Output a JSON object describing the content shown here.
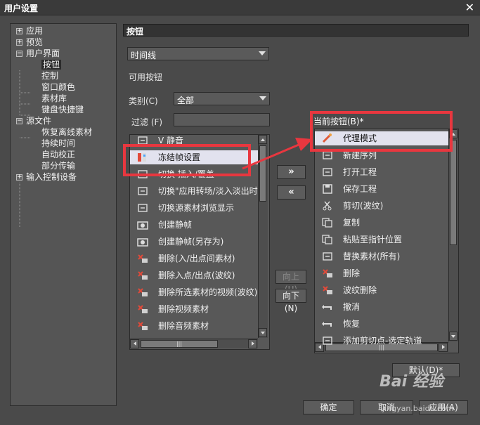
{
  "window": {
    "title": "用户设置",
    "close_glyph": "✕"
  },
  "tree": [
    {
      "label": "应用",
      "level": 0,
      "expander": "+"
    },
    {
      "label": "预览",
      "level": 0,
      "expander": "+"
    },
    {
      "label": "用户界面",
      "level": 0,
      "expander": "−"
    },
    {
      "label": "按钮",
      "level": 1,
      "selected": true
    },
    {
      "label": "控制",
      "level": 1
    },
    {
      "label": "窗口颜色",
      "level": 1
    },
    {
      "label": "素材库",
      "level": 1
    },
    {
      "label": "键盘快捷键",
      "level": 1
    },
    {
      "label": "源文件",
      "level": 0,
      "expander": "−"
    },
    {
      "label": "恢复离线素材",
      "level": 1
    },
    {
      "label": "持续时间",
      "level": 1
    },
    {
      "label": "自动校正",
      "level": 1
    },
    {
      "label": "部分传输",
      "level": 1
    },
    {
      "label": "输入控制设备",
      "level": 0,
      "expander": "+"
    }
  ],
  "section_title": "按钮",
  "view_combo": {
    "value": "时间线"
  },
  "available_buttons_label": "可用按钮",
  "category": {
    "label": "类别(C)",
    "value": "全部"
  },
  "filter": {
    "label": "过滤 (F)",
    "value": ""
  },
  "current_buttons_label": "当前按钮(B)*",
  "available_items": [
    {
      "label": "V 静音",
      "icon": "mute-icon"
    },
    {
      "label": "冻结帧设置",
      "icon": "freeze-frame-icon",
      "highlighted": true
    },
    {
      "label": "切换 插入/覆盖",
      "icon": "insert-overwrite-icon"
    },
    {
      "label": "切换\"应用转场/淡入淡出时",
      "icon": "transition-icon"
    },
    {
      "label": "切换源素材浏览显示",
      "icon": "source-view-icon"
    },
    {
      "label": "创建静帧",
      "icon": "camera-icon"
    },
    {
      "label": "创建静帧(另存为)",
      "icon": "camera-save-icon"
    },
    {
      "label": "删除(入/出点间素材)",
      "icon": "delete-inout-icon"
    },
    {
      "label": "删除入点/出点(波纹)",
      "icon": "delete-ripple-icon"
    },
    {
      "label": "删除所选素材的视频(波纹)",
      "icon": "delete-video-ripple-icon"
    },
    {
      "label": "删除视频素材",
      "icon": "delete-video-icon"
    },
    {
      "label": "删除音频素材",
      "icon": "delete-audio-icon"
    }
  ],
  "current_items": [
    {
      "label": "代理模式",
      "icon": "proxy-icon",
      "highlighted": true
    },
    {
      "label": "新建序列",
      "icon": "new-sequence-icon"
    },
    {
      "label": "打开工程",
      "icon": "open-project-icon"
    },
    {
      "label": "保存工程",
      "icon": "save-icon"
    },
    {
      "label": "剪切(波纹)",
      "icon": "scissors-icon"
    },
    {
      "label": "复制",
      "icon": "copy-icon"
    },
    {
      "label": "粘贴至指针位置",
      "icon": "paste-icon"
    },
    {
      "label": "替换素材(所有)",
      "icon": "replace-icon"
    },
    {
      "label": "删除",
      "icon": "delete-icon"
    },
    {
      "label": "波纹删除",
      "icon": "ripple-delete-icon"
    },
    {
      "label": "撤消",
      "icon": "undo-icon"
    },
    {
      "label": "恢复",
      "icon": "redo-icon"
    },
    {
      "label": "添加剪切点-选定轨道",
      "icon": "add-cut-icon"
    }
  ],
  "buttons": {
    "add": "»",
    "remove": "«",
    "move_up": "向上(U)",
    "move_down": "向下(N)",
    "default": "默认(D)*",
    "ok": "确定",
    "cancel": "取消",
    "apply": "应用(A)"
  },
  "scroll_glyph": "|||",
  "watermark": {
    "text": "Bai 经验",
    "sub": "jingyan.baidu.com"
  },
  "colors": {
    "highlight": "#e8373f",
    "selected_item_bg": "#e2e2ee",
    "panel_bg": "#4a4a4a"
  }
}
